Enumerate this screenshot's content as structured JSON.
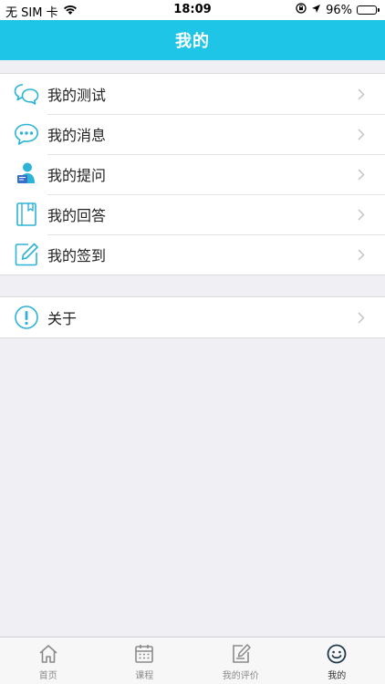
{
  "status_bar": {
    "carrier": "无 SIM 卡",
    "time": "18:09",
    "battery": "96%",
    "battery_level": 0.96
  },
  "nav": {
    "title": "我的"
  },
  "menu_group_1": [
    {
      "label": "我的测试",
      "icon": "chat-bubbles-icon"
    },
    {
      "label": "我的消息",
      "icon": "message-dots-icon"
    },
    {
      "label": "我的提问",
      "icon": "person-question-icon"
    },
    {
      "label": "我的回答",
      "icon": "notebook-icon"
    },
    {
      "label": "我的签到",
      "icon": "edit-pencil-icon"
    }
  ],
  "menu_group_2": [
    {
      "label": "关于",
      "icon": "info-exclamation-icon"
    }
  ],
  "tabs": [
    {
      "label": "首页",
      "icon": "home-icon",
      "active": false
    },
    {
      "label": "课程",
      "icon": "calendar-icon",
      "active": false
    },
    {
      "label": "我的评价",
      "icon": "edit-doc-icon",
      "active": false
    },
    {
      "label": "我的",
      "icon": "smiley-icon",
      "active": true
    }
  ],
  "colors": {
    "accent": "#1ec5e6",
    "icon_blue": "#2bb3d9",
    "tab_inactive": "#8a8a8a",
    "tab_active": "#1f3a4a"
  }
}
